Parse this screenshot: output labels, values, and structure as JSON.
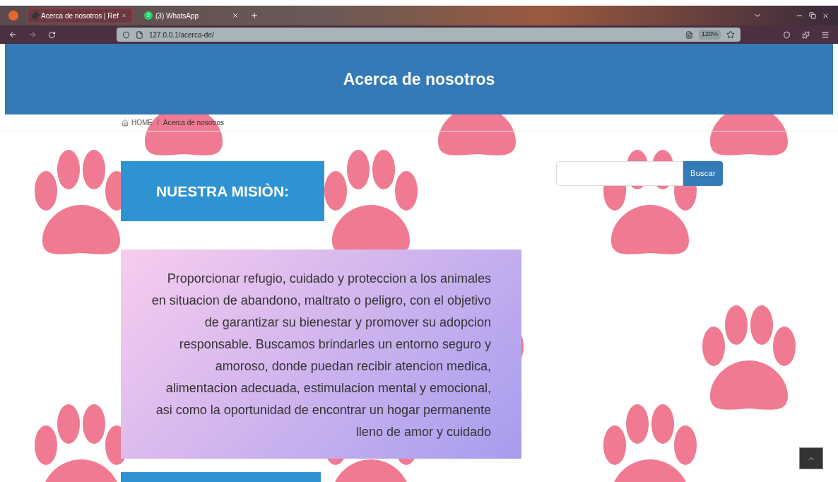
{
  "browser": {
    "tabs": [
      {
        "title": "Acerca de nosotros | Ref",
        "selected": true
      },
      {
        "title": "(3) WhatsApp",
        "badge": "2",
        "selected": false
      }
    ],
    "address": "127.0.0.1/acerca-de/",
    "zoom": "120%"
  },
  "header": {
    "title": "Acerca de nosotros"
  },
  "breadcrumb": [
    {
      "label": "HOME",
      "kind": "home"
    },
    {
      "label": "/",
      "kind": "separator"
    },
    {
      "label": "Acerca de nosotros",
      "kind": "current"
    }
  ],
  "mission": {
    "heading": "NUESTRA MISIÒN:",
    "text": "Proporcionar refugio, cuidado y proteccion a los animales en situacion de abandono, maltrato o peligro, con el objetivo de garantizar su bienestar y promover su adopcion responsable. Buscamos brindarles un entorno seguro y amoroso, donde puedan recibir atencion medica, alimentacion adecuada, estimulacion mental y emocional, asi como la oportunidad de encontrar un hogar permanente lleno de amor y cuidado"
  },
  "search": {
    "button": "Buscar"
  }
}
